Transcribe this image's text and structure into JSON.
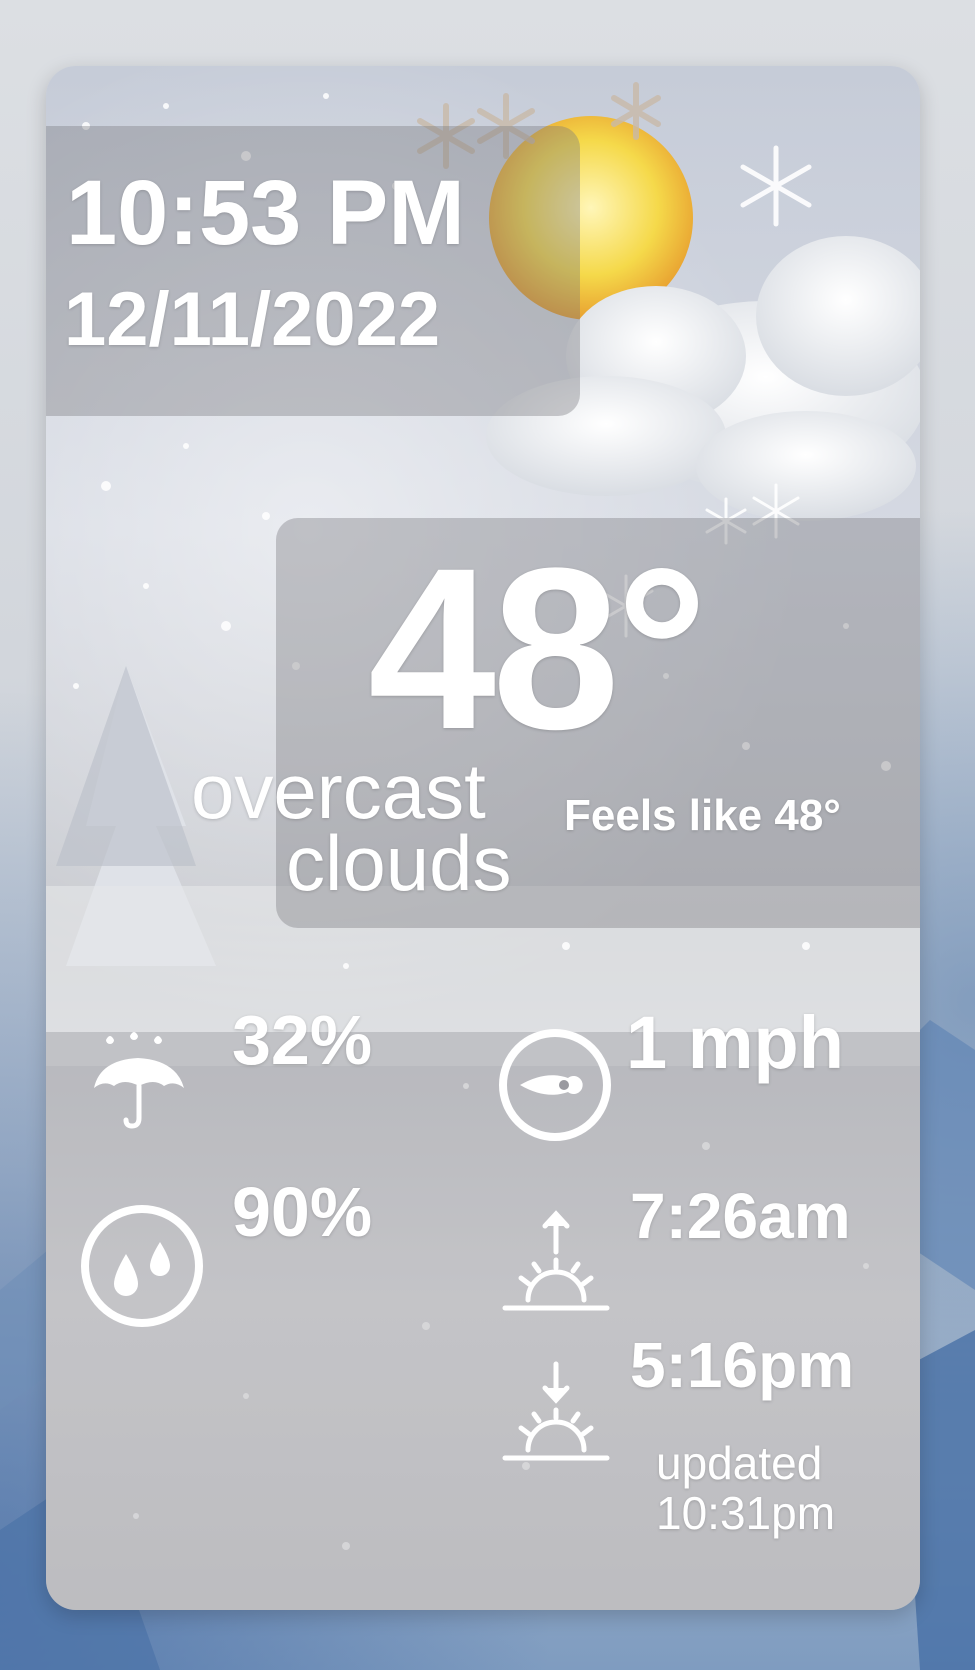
{
  "clock": {
    "time": "10:53 PM",
    "date": "12/11/2022"
  },
  "current": {
    "temperature": "48°",
    "condition_line1": "overcast",
    "condition_line2": "clouds",
    "feels_like": "Feels like 48°",
    "weather_icon": "snow-sun-cloud-icon"
  },
  "stats": {
    "precipitation": {
      "icon": "umbrella-rain-icon",
      "value": "32%"
    },
    "wind": {
      "icon": "wind-compass-icon",
      "value": "1 mph"
    },
    "humidity": {
      "icon": "humidity-drops-icon",
      "value": "90%"
    },
    "sunrise": {
      "icon": "sunrise-icon",
      "value": "7:26am"
    },
    "sunset": {
      "icon": "sunset-icon",
      "value": "5:16pm"
    }
  },
  "updated": {
    "label": "updated",
    "time": "10:31pm"
  },
  "colors": {
    "text": "#ffffff",
    "panel": "#78787d",
    "sun": "#f5d94a"
  }
}
